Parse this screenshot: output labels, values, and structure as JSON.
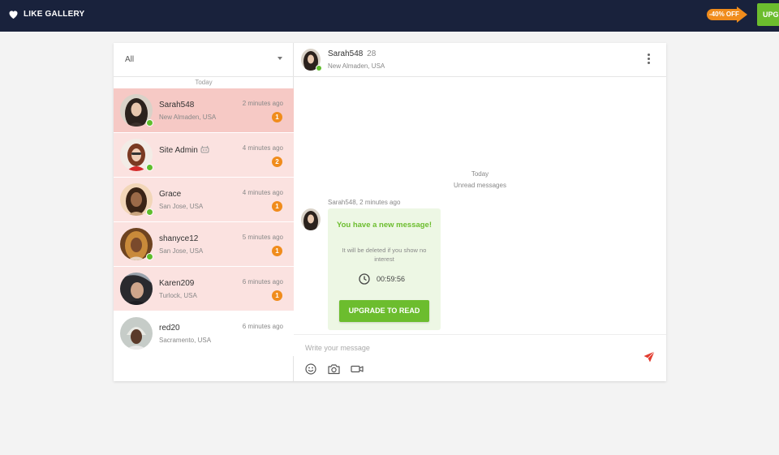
{
  "header": {
    "brand": "LIKE GALLERY",
    "promo": "-40% OFF",
    "upgrade": "UPG"
  },
  "colors": {
    "topbar": "#19223c",
    "accent_green": "#6cbd2e",
    "badge_orange": "#f08c1c",
    "active_row": "#f6c9c5",
    "unread_row": "#fbe2e0",
    "send_red": "#e23b2e"
  },
  "filter": {
    "selected": "All"
  },
  "list": {
    "day": "Today",
    "conversations": [
      {
        "name": "Sarah548",
        "location": "New Almaden, USA",
        "time": "2 minutes ago",
        "unread": "1",
        "online": true,
        "state": "active"
      },
      {
        "name": "Site Admin",
        "location": "",
        "time": "4 minutes ago",
        "unread": "2",
        "online": true,
        "state": "unread",
        "icon": "robot-icon"
      },
      {
        "name": "Grace",
        "location": "San Jose, USA",
        "time": "4 minutes ago",
        "unread": "1",
        "online": true,
        "state": "unread"
      },
      {
        "name": "shanyce12",
        "location": "San Jose, USA",
        "time": "5 minutes ago",
        "unread": "1",
        "online": true,
        "state": "unread"
      },
      {
        "name": "Karen209",
        "location": "Turlock, USA",
        "time": "6 minutes ago",
        "unread": "1",
        "online": false,
        "state": "unread"
      },
      {
        "name": "red20",
        "location": "Sacramento, USA",
        "time": "6 minutes ago",
        "unread": "",
        "online": false,
        "state": "read"
      }
    ]
  },
  "chat": {
    "name": "Sarah548",
    "age": "28",
    "location": "New Almaden, USA",
    "day": "Today",
    "unread_label": "Unread messages",
    "message": {
      "meta": "Sarah548, 2 minutes ago",
      "title": "You have a new message!",
      "subtitle": "It will be deleted if you show no interest",
      "timer": "00:59:56",
      "cta": "UPGRADE TO READ"
    },
    "composer": {
      "placeholder": "Write your message",
      "tools": [
        "smile-icon",
        "camera-icon",
        "video-icon"
      ],
      "send_icon": "send-icon"
    }
  }
}
